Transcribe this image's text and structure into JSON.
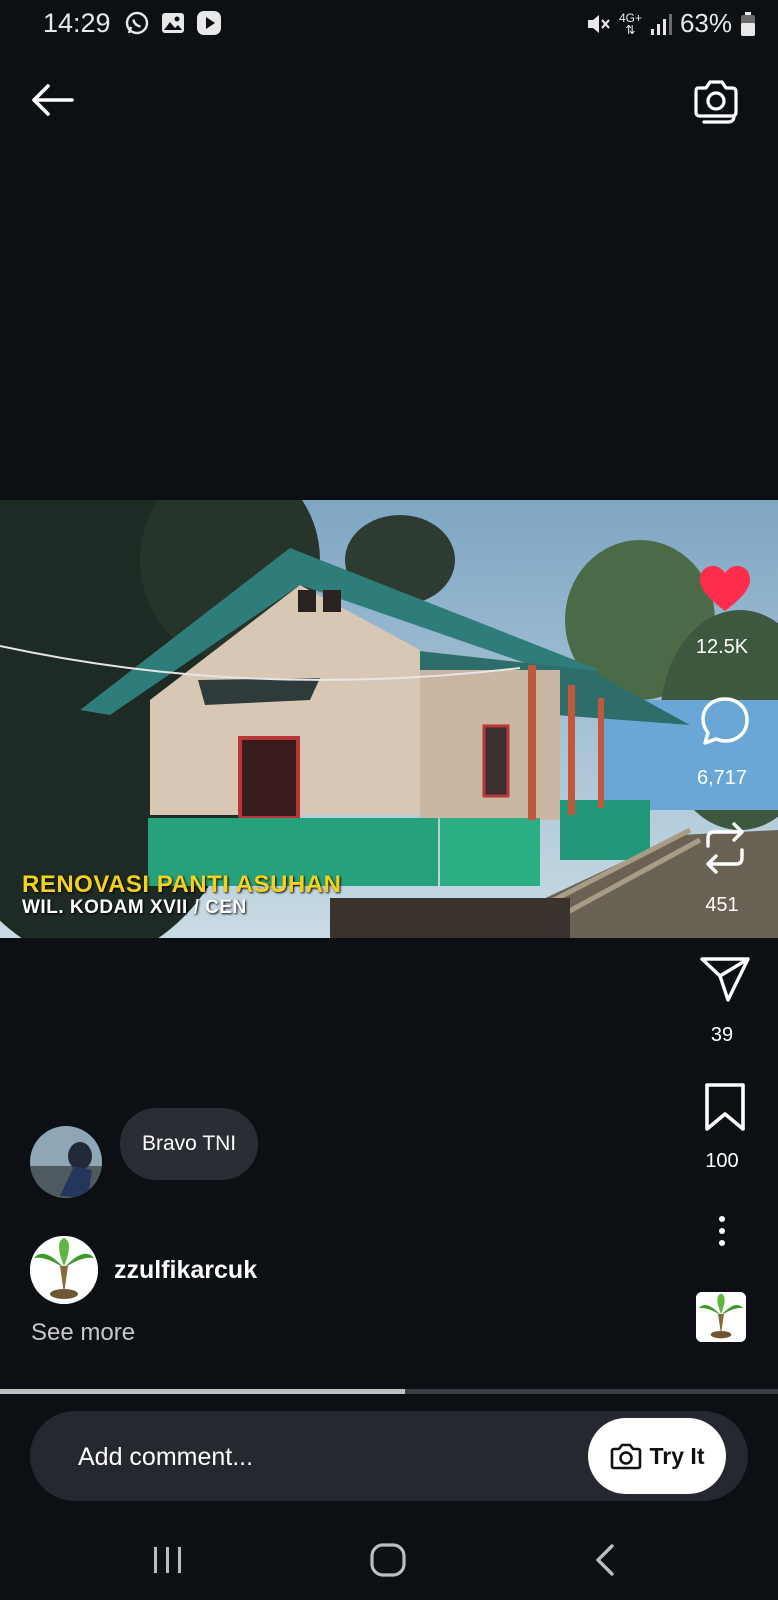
{
  "status_bar": {
    "time": "14:29",
    "battery": "63%",
    "network": "4G+",
    "icons": [
      "whatsapp-icon",
      "gallery-icon",
      "play-icon",
      "mute-icon",
      "signal-icon",
      "battery-icon"
    ]
  },
  "header": {
    "back_icon": "arrow-left-icon",
    "camera_icon": "camera-icon"
  },
  "media": {
    "caption_line1": "RENOVASI PANTI ASUHAN",
    "caption_line2": "WIL. KODAM XVII / CEN"
  },
  "actions": {
    "likes": "12.5K",
    "comments": "6,717",
    "reposts": "451",
    "shares": "39",
    "saves": "100",
    "like_color": "#ff2d4a"
  },
  "comment_preview": {
    "text": "Bravo TNI"
  },
  "post": {
    "author": "zzulfikarcuk",
    "see_more": "See more"
  },
  "progress": {
    "fraction": 0.52
  },
  "composer": {
    "placeholder": "Add comment...",
    "try_it_label": "Try It"
  },
  "colors": {
    "background": "#0c0f14",
    "accent_caption": "#f4d21a"
  }
}
